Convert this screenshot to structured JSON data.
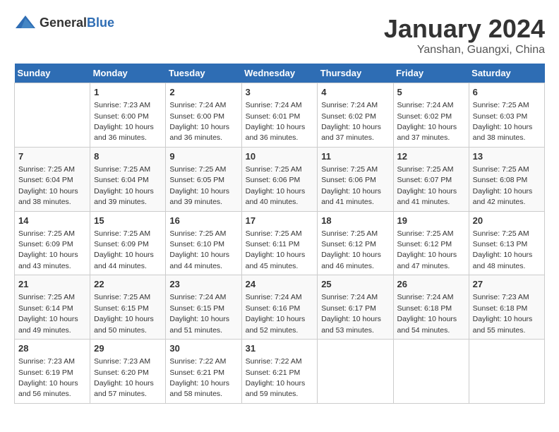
{
  "header": {
    "logo_general": "General",
    "logo_blue": "Blue",
    "month_title": "January 2024",
    "location": "Yanshan, Guangxi, China"
  },
  "days_of_week": [
    "Sunday",
    "Monday",
    "Tuesday",
    "Wednesday",
    "Thursday",
    "Friday",
    "Saturday"
  ],
  "weeks": [
    [
      {
        "day": "",
        "info": ""
      },
      {
        "day": "1",
        "info": "Sunrise: 7:23 AM\nSunset: 6:00 PM\nDaylight: 10 hours\nand 36 minutes."
      },
      {
        "day": "2",
        "info": "Sunrise: 7:24 AM\nSunset: 6:00 PM\nDaylight: 10 hours\nand 36 minutes."
      },
      {
        "day": "3",
        "info": "Sunrise: 7:24 AM\nSunset: 6:01 PM\nDaylight: 10 hours\nand 36 minutes."
      },
      {
        "day": "4",
        "info": "Sunrise: 7:24 AM\nSunset: 6:02 PM\nDaylight: 10 hours\nand 37 minutes."
      },
      {
        "day": "5",
        "info": "Sunrise: 7:24 AM\nSunset: 6:02 PM\nDaylight: 10 hours\nand 37 minutes."
      },
      {
        "day": "6",
        "info": "Sunrise: 7:25 AM\nSunset: 6:03 PM\nDaylight: 10 hours\nand 38 minutes."
      }
    ],
    [
      {
        "day": "7",
        "info": "Sunrise: 7:25 AM\nSunset: 6:04 PM\nDaylight: 10 hours\nand 38 minutes."
      },
      {
        "day": "8",
        "info": "Sunrise: 7:25 AM\nSunset: 6:04 PM\nDaylight: 10 hours\nand 39 minutes."
      },
      {
        "day": "9",
        "info": "Sunrise: 7:25 AM\nSunset: 6:05 PM\nDaylight: 10 hours\nand 39 minutes."
      },
      {
        "day": "10",
        "info": "Sunrise: 7:25 AM\nSunset: 6:06 PM\nDaylight: 10 hours\nand 40 minutes."
      },
      {
        "day": "11",
        "info": "Sunrise: 7:25 AM\nSunset: 6:06 PM\nDaylight: 10 hours\nand 41 minutes."
      },
      {
        "day": "12",
        "info": "Sunrise: 7:25 AM\nSunset: 6:07 PM\nDaylight: 10 hours\nand 41 minutes."
      },
      {
        "day": "13",
        "info": "Sunrise: 7:25 AM\nSunset: 6:08 PM\nDaylight: 10 hours\nand 42 minutes."
      }
    ],
    [
      {
        "day": "14",
        "info": "Sunrise: 7:25 AM\nSunset: 6:09 PM\nDaylight: 10 hours\nand 43 minutes."
      },
      {
        "day": "15",
        "info": "Sunrise: 7:25 AM\nSunset: 6:09 PM\nDaylight: 10 hours\nand 44 minutes."
      },
      {
        "day": "16",
        "info": "Sunrise: 7:25 AM\nSunset: 6:10 PM\nDaylight: 10 hours\nand 44 minutes."
      },
      {
        "day": "17",
        "info": "Sunrise: 7:25 AM\nSunset: 6:11 PM\nDaylight: 10 hours\nand 45 minutes."
      },
      {
        "day": "18",
        "info": "Sunrise: 7:25 AM\nSunset: 6:12 PM\nDaylight: 10 hours\nand 46 minutes."
      },
      {
        "day": "19",
        "info": "Sunrise: 7:25 AM\nSunset: 6:12 PM\nDaylight: 10 hours\nand 47 minutes."
      },
      {
        "day": "20",
        "info": "Sunrise: 7:25 AM\nSunset: 6:13 PM\nDaylight: 10 hours\nand 48 minutes."
      }
    ],
    [
      {
        "day": "21",
        "info": "Sunrise: 7:25 AM\nSunset: 6:14 PM\nDaylight: 10 hours\nand 49 minutes."
      },
      {
        "day": "22",
        "info": "Sunrise: 7:25 AM\nSunset: 6:15 PM\nDaylight: 10 hours\nand 50 minutes."
      },
      {
        "day": "23",
        "info": "Sunrise: 7:24 AM\nSunset: 6:15 PM\nDaylight: 10 hours\nand 51 minutes."
      },
      {
        "day": "24",
        "info": "Sunrise: 7:24 AM\nSunset: 6:16 PM\nDaylight: 10 hours\nand 52 minutes."
      },
      {
        "day": "25",
        "info": "Sunrise: 7:24 AM\nSunset: 6:17 PM\nDaylight: 10 hours\nand 53 minutes."
      },
      {
        "day": "26",
        "info": "Sunrise: 7:24 AM\nSunset: 6:18 PM\nDaylight: 10 hours\nand 54 minutes."
      },
      {
        "day": "27",
        "info": "Sunrise: 7:23 AM\nSunset: 6:18 PM\nDaylight: 10 hours\nand 55 minutes."
      }
    ],
    [
      {
        "day": "28",
        "info": "Sunrise: 7:23 AM\nSunset: 6:19 PM\nDaylight: 10 hours\nand 56 minutes."
      },
      {
        "day": "29",
        "info": "Sunrise: 7:23 AM\nSunset: 6:20 PM\nDaylight: 10 hours\nand 57 minutes."
      },
      {
        "day": "30",
        "info": "Sunrise: 7:22 AM\nSunset: 6:21 PM\nDaylight: 10 hours\nand 58 minutes."
      },
      {
        "day": "31",
        "info": "Sunrise: 7:22 AM\nSunset: 6:21 PM\nDaylight: 10 hours\nand 59 minutes."
      },
      {
        "day": "",
        "info": ""
      },
      {
        "day": "",
        "info": ""
      },
      {
        "day": "",
        "info": ""
      }
    ]
  ]
}
